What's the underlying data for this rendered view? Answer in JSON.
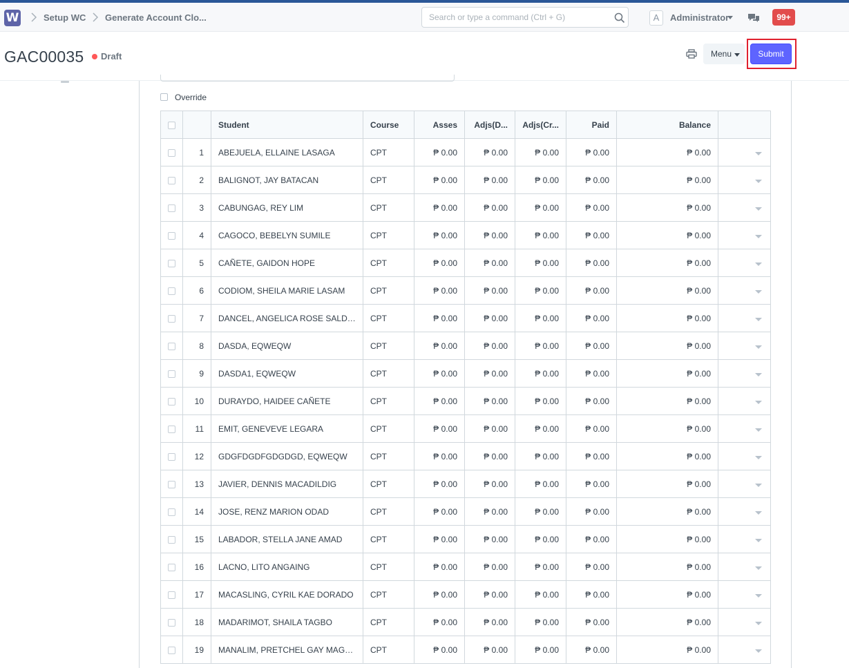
{
  "navbar": {
    "logo_letter": "W",
    "breadcrumbs": [
      "Setup WC",
      "Generate Account Clo..."
    ],
    "search_placeholder": "Search or type a command (Ctrl + G)",
    "avatar_letter": "A",
    "user_name": "Administrator",
    "notification_count": "99+"
  },
  "page": {
    "title": "GAC00035",
    "status": "Draft",
    "menu_label": "Menu",
    "submit_label": "Submit"
  },
  "form": {
    "override_label": "Override"
  },
  "table": {
    "headers": [
      "Student",
      "Course",
      "Asses",
      "Adjs(D...",
      "Adjs(Cr...",
      "Paid",
      "Balance"
    ],
    "rows": [
      {
        "no": "1",
        "student": "ABEJUELA, ELLAINE LASAGA",
        "course": "CPT",
        "asses": "₱ 0.00",
        "adjs_d": "₱ 0.00",
        "adjs_cr": "₱ 0.00",
        "paid": "₱ 0.00",
        "balance": "₱ 0.00"
      },
      {
        "no": "2",
        "student": "BALIGNOT, JAY BATACAN",
        "course": "CPT",
        "asses": "₱ 0.00",
        "adjs_d": "₱ 0.00",
        "adjs_cr": "₱ 0.00",
        "paid": "₱ 0.00",
        "balance": "₱ 0.00"
      },
      {
        "no": "3",
        "student": "CABUNGAG, REY LIM",
        "course": "CPT",
        "asses": "₱ 0.00",
        "adjs_d": "₱ 0.00",
        "adjs_cr": "₱ 0.00",
        "paid": "₱ 0.00",
        "balance": "₱ 0.00"
      },
      {
        "no": "4",
        "student": "CAGOCO, BEBELYN SUMILE",
        "course": "CPT",
        "asses": "₱ 0.00",
        "adjs_d": "₱ 0.00",
        "adjs_cr": "₱ 0.00",
        "paid": "₱ 0.00",
        "balance": "₱ 0.00"
      },
      {
        "no": "5",
        "student": "CAÑETE, GAIDON HOPE",
        "course": "CPT",
        "asses": "₱ 0.00",
        "adjs_d": "₱ 0.00",
        "adjs_cr": "₱ 0.00",
        "paid": "₱ 0.00",
        "balance": "₱ 0.00"
      },
      {
        "no": "6",
        "student": "CODIOM, SHEILA MARIE LASAM",
        "course": "CPT",
        "asses": "₱ 0.00",
        "adjs_d": "₱ 0.00",
        "adjs_cr": "₱ 0.00",
        "paid": "₱ 0.00",
        "balance": "₱ 0.00"
      },
      {
        "no": "7",
        "student": "DANCEL, ANGELICA ROSE SALDIVAR",
        "course": "CPT",
        "asses": "₱ 0.00",
        "adjs_d": "₱ 0.00",
        "adjs_cr": "₱ 0.00",
        "paid": "₱ 0.00",
        "balance": "₱ 0.00"
      },
      {
        "no": "8",
        "student": "DASDA, EQWEQW",
        "course": "CPT",
        "asses": "₱ 0.00",
        "adjs_d": "₱ 0.00",
        "adjs_cr": "₱ 0.00",
        "paid": "₱ 0.00",
        "balance": "₱ 0.00"
      },
      {
        "no": "9",
        "student": "DASDA1, EQWEQW",
        "course": "CPT",
        "asses": "₱ 0.00",
        "adjs_d": "₱ 0.00",
        "adjs_cr": "₱ 0.00",
        "paid": "₱ 0.00",
        "balance": "₱ 0.00"
      },
      {
        "no": "10",
        "student": "DURAYDO, HAIDEE CAÑETE",
        "course": "CPT",
        "asses": "₱ 0.00",
        "adjs_d": "₱ 0.00",
        "adjs_cr": "₱ 0.00",
        "paid": "₱ 0.00",
        "balance": "₱ 0.00"
      },
      {
        "no": "11",
        "student": "EMIT, GENEVEVE LEGARA",
        "course": "CPT",
        "asses": "₱ 0.00",
        "adjs_d": "₱ 0.00",
        "adjs_cr": "₱ 0.00",
        "paid": "₱ 0.00",
        "balance": "₱ 0.00"
      },
      {
        "no": "12",
        "student": "GDGFDGDFGDGDGD, EQWEQW",
        "course": "CPT",
        "asses": "₱ 0.00",
        "adjs_d": "₱ 0.00",
        "adjs_cr": "₱ 0.00",
        "paid": "₱ 0.00",
        "balance": "₱ 0.00"
      },
      {
        "no": "13",
        "student": "JAVIER, DENNIS MACADILDIG",
        "course": "CPT",
        "asses": "₱ 0.00",
        "adjs_d": "₱ 0.00",
        "adjs_cr": "₱ 0.00",
        "paid": "₱ 0.00",
        "balance": "₱ 0.00"
      },
      {
        "no": "14",
        "student": "JOSE, RENZ MARION ODAD",
        "course": "CPT",
        "asses": "₱ 0.00",
        "adjs_d": "₱ 0.00",
        "adjs_cr": "₱ 0.00",
        "paid": "₱ 0.00",
        "balance": "₱ 0.00"
      },
      {
        "no": "15",
        "student": "LABADOR, STELLA JANE AMAD",
        "course": "CPT",
        "asses": "₱ 0.00",
        "adjs_d": "₱ 0.00",
        "adjs_cr": "₱ 0.00",
        "paid": "₱ 0.00",
        "balance": "₱ 0.00"
      },
      {
        "no": "16",
        "student": "LACNO, LITO ANGAING",
        "course": "CPT",
        "asses": "₱ 0.00",
        "adjs_d": "₱ 0.00",
        "adjs_cr": "₱ 0.00",
        "paid": "₱ 0.00",
        "balance": "₱ 0.00"
      },
      {
        "no": "17",
        "student": "MACASLING, CYRIL KAE DORADO",
        "course": "CPT",
        "asses": "₱ 0.00",
        "adjs_d": "₱ 0.00",
        "adjs_cr": "₱ 0.00",
        "paid": "₱ 0.00",
        "balance": "₱ 0.00"
      },
      {
        "no": "18",
        "student": "MADARIMOT, SHAILA TAGBO",
        "course": "CPT",
        "asses": "₱ 0.00",
        "adjs_d": "₱ 0.00",
        "adjs_cr": "₱ 0.00",
        "paid": "₱ 0.00",
        "balance": "₱ 0.00"
      },
      {
        "no": "19",
        "student": "MANALIM, PRETCHEL GAY MAGDA...",
        "course": "CPT",
        "asses": "₱ 0.00",
        "adjs_d": "₱ 0.00",
        "adjs_cr": "₱ 0.00",
        "paid": "₱ 0.00",
        "balance": "₱ 0.00"
      }
    ]
  },
  "colors": {
    "accent_bar": "#2b5797",
    "logo": "#5e64a8",
    "submit": "#5e64ff",
    "notification": "#e24c4c",
    "draft_dot": "#ff5858",
    "highlight_box": "#e0202e"
  },
  "icons": [
    "logo-icon",
    "chevron-right-icon",
    "search-icon",
    "chevron-down-icon",
    "chat-icon",
    "printer-icon",
    "row-dropdown-icon"
  ]
}
